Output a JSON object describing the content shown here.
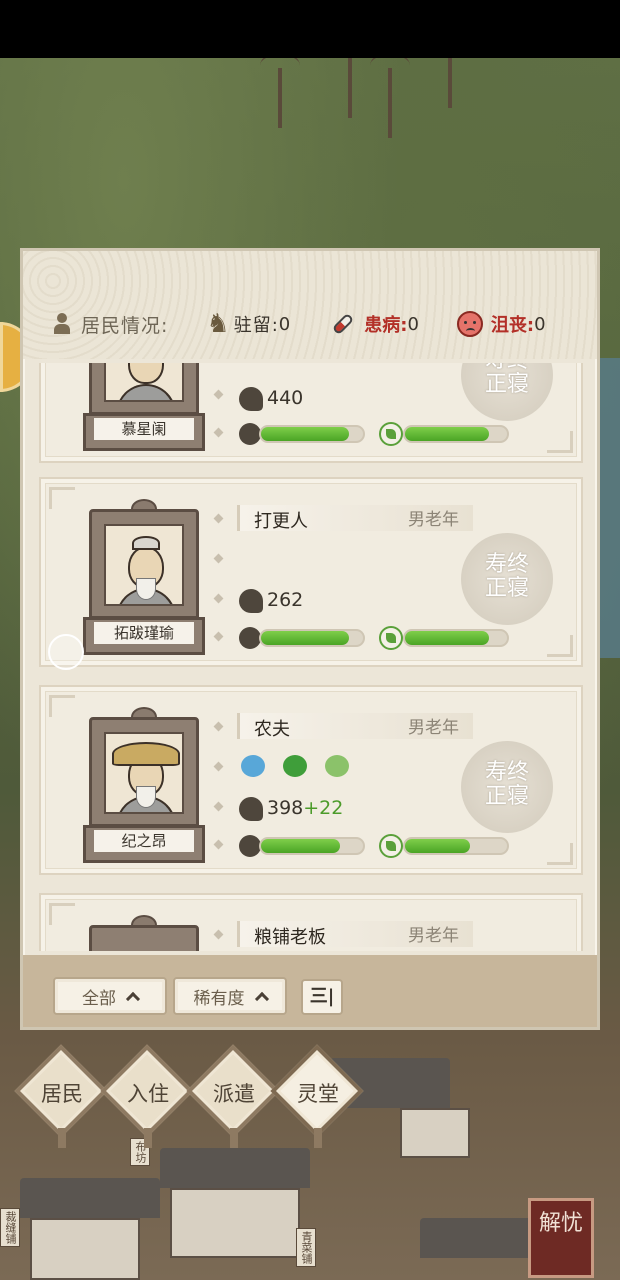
{
  "header": {
    "status_label": "居民情况:",
    "stationed_label": "驻留:",
    "stationed_value": "0",
    "sick_label": "患病:",
    "sick_value": "0",
    "depressed_label": "沮丧:",
    "depressed_value": "0"
  },
  "residents": [
    {
      "name": "慕星阑",
      "job": "",
      "age_group": "",
      "wealth": "440",
      "wealth_bonus": "",
      "health": 0.86,
      "mood": 0.82,
      "stamp": "寿终正寝"
    },
    {
      "name": "拓跋瑾瑜",
      "job": "打更人",
      "age_group": "男老年",
      "wealth": "262",
      "wealth_bonus": "",
      "health": 0.86,
      "mood": 0.82,
      "stamp": "寿终正寝"
    },
    {
      "name": "纪之昂",
      "job": "农夫",
      "age_group": "男老年",
      "wealth": "398",
      "wealth_bonus": "+22",
      "health": 0.77,
      "mood": 0.64,
      "traits": [
        "wave-icon",
        "sprout-icon",
        "grass-icon"
      ],
      "stamp": "寿终正寝"
    },
    {
      "name": "",
      "job": "粮铺老板",
      "age_group": "男老年"
    }
  ],
  "footer": {
    "filter_all": "全部",
    "filter_rarity": "稀有度",
    "sort_label": "三|"
  },
  "tabs": [
    {
      "label": "居民"
    },
    {
      "label": "入住"
    },
    {
      "label": "派遣"
    },
    {
      "label": "灵堂"
    }
  ],
  "corner_button": "解忧",
  "signs": [
    "布坊",
    "裁缝铺",
    "青菜铺"
  ],
  "colors": {
    "bar_fill": "#5fb730",
    "alert_red": "#b33028",
    "panel_bg": "#ece6d8"
  }
}
